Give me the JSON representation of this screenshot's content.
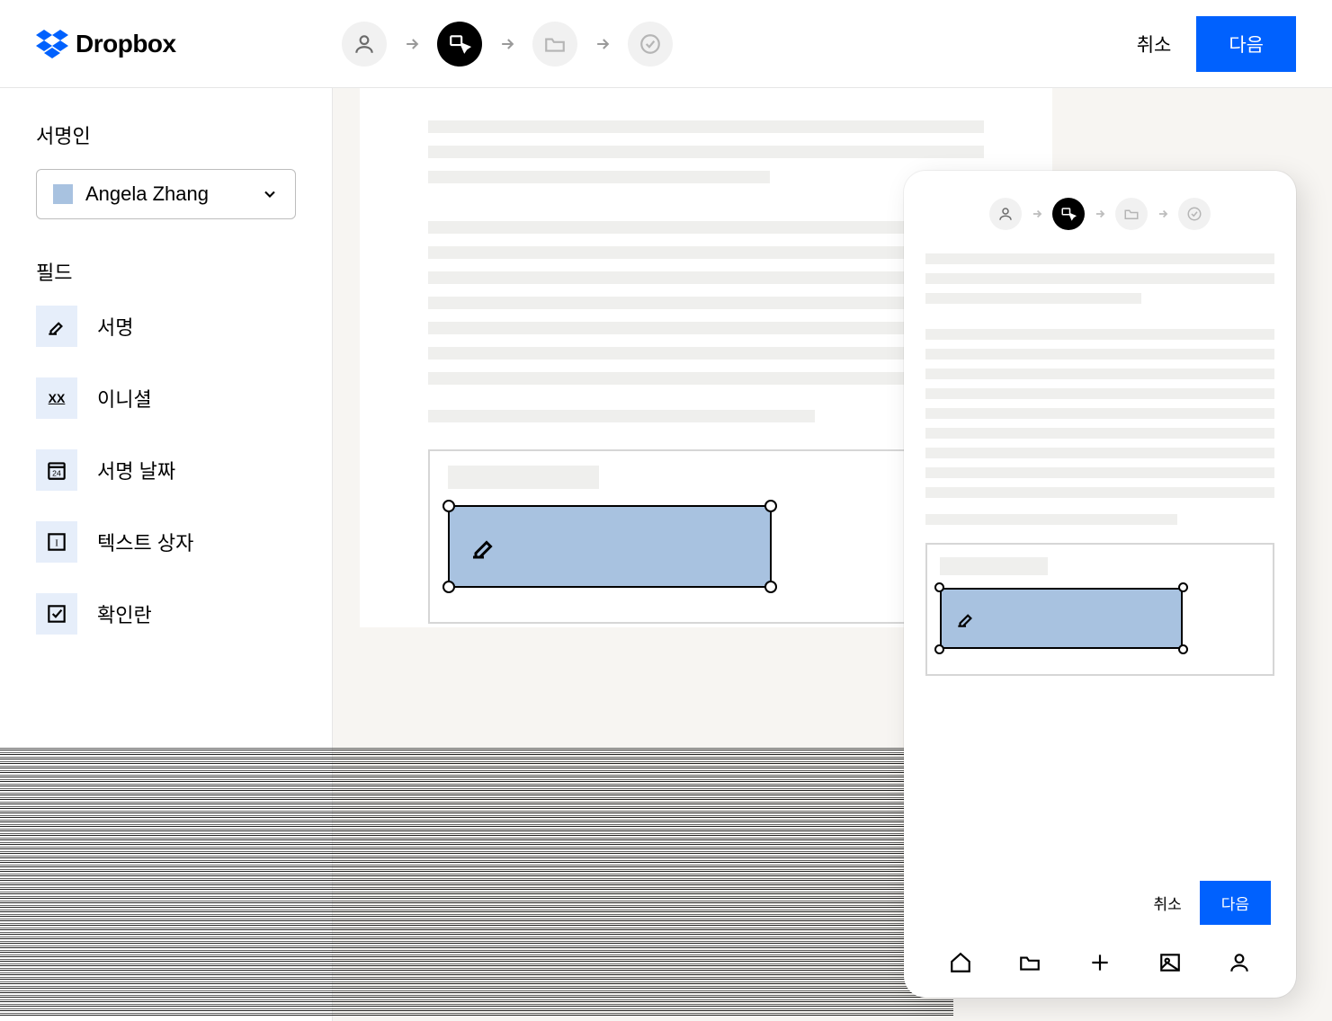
{
  "brand": "Dropbox",
  "header": {
    "cancel": "취소",
    "next": "다음"
  },
  "sidebar": {
    "signer_section_label": "서명인",
    "signer_name": "Angela Zhang",
    "fields_section_label": "필드",
    "fields": {
      "signature": "서명",
      "initials": "이니셜",
      "date_signed": "서명 날짜",
      "textbox": "텍스트 상자",
      "checkbox": "확인란"
    }
  },
  "mobile": {
    "cancel": "취소",
    "next": "다음"
  },
  "icons": {
    "date_badge_number": "24",
    "initials_glyph": "XX",
    "textbox_glyph": "I"
  },
  "colors": {
    "primary": "#0061FE",
    "signer_chip": "#a8c2e0",
    "field_icon_bg": "#e6eefa"
  }
}
